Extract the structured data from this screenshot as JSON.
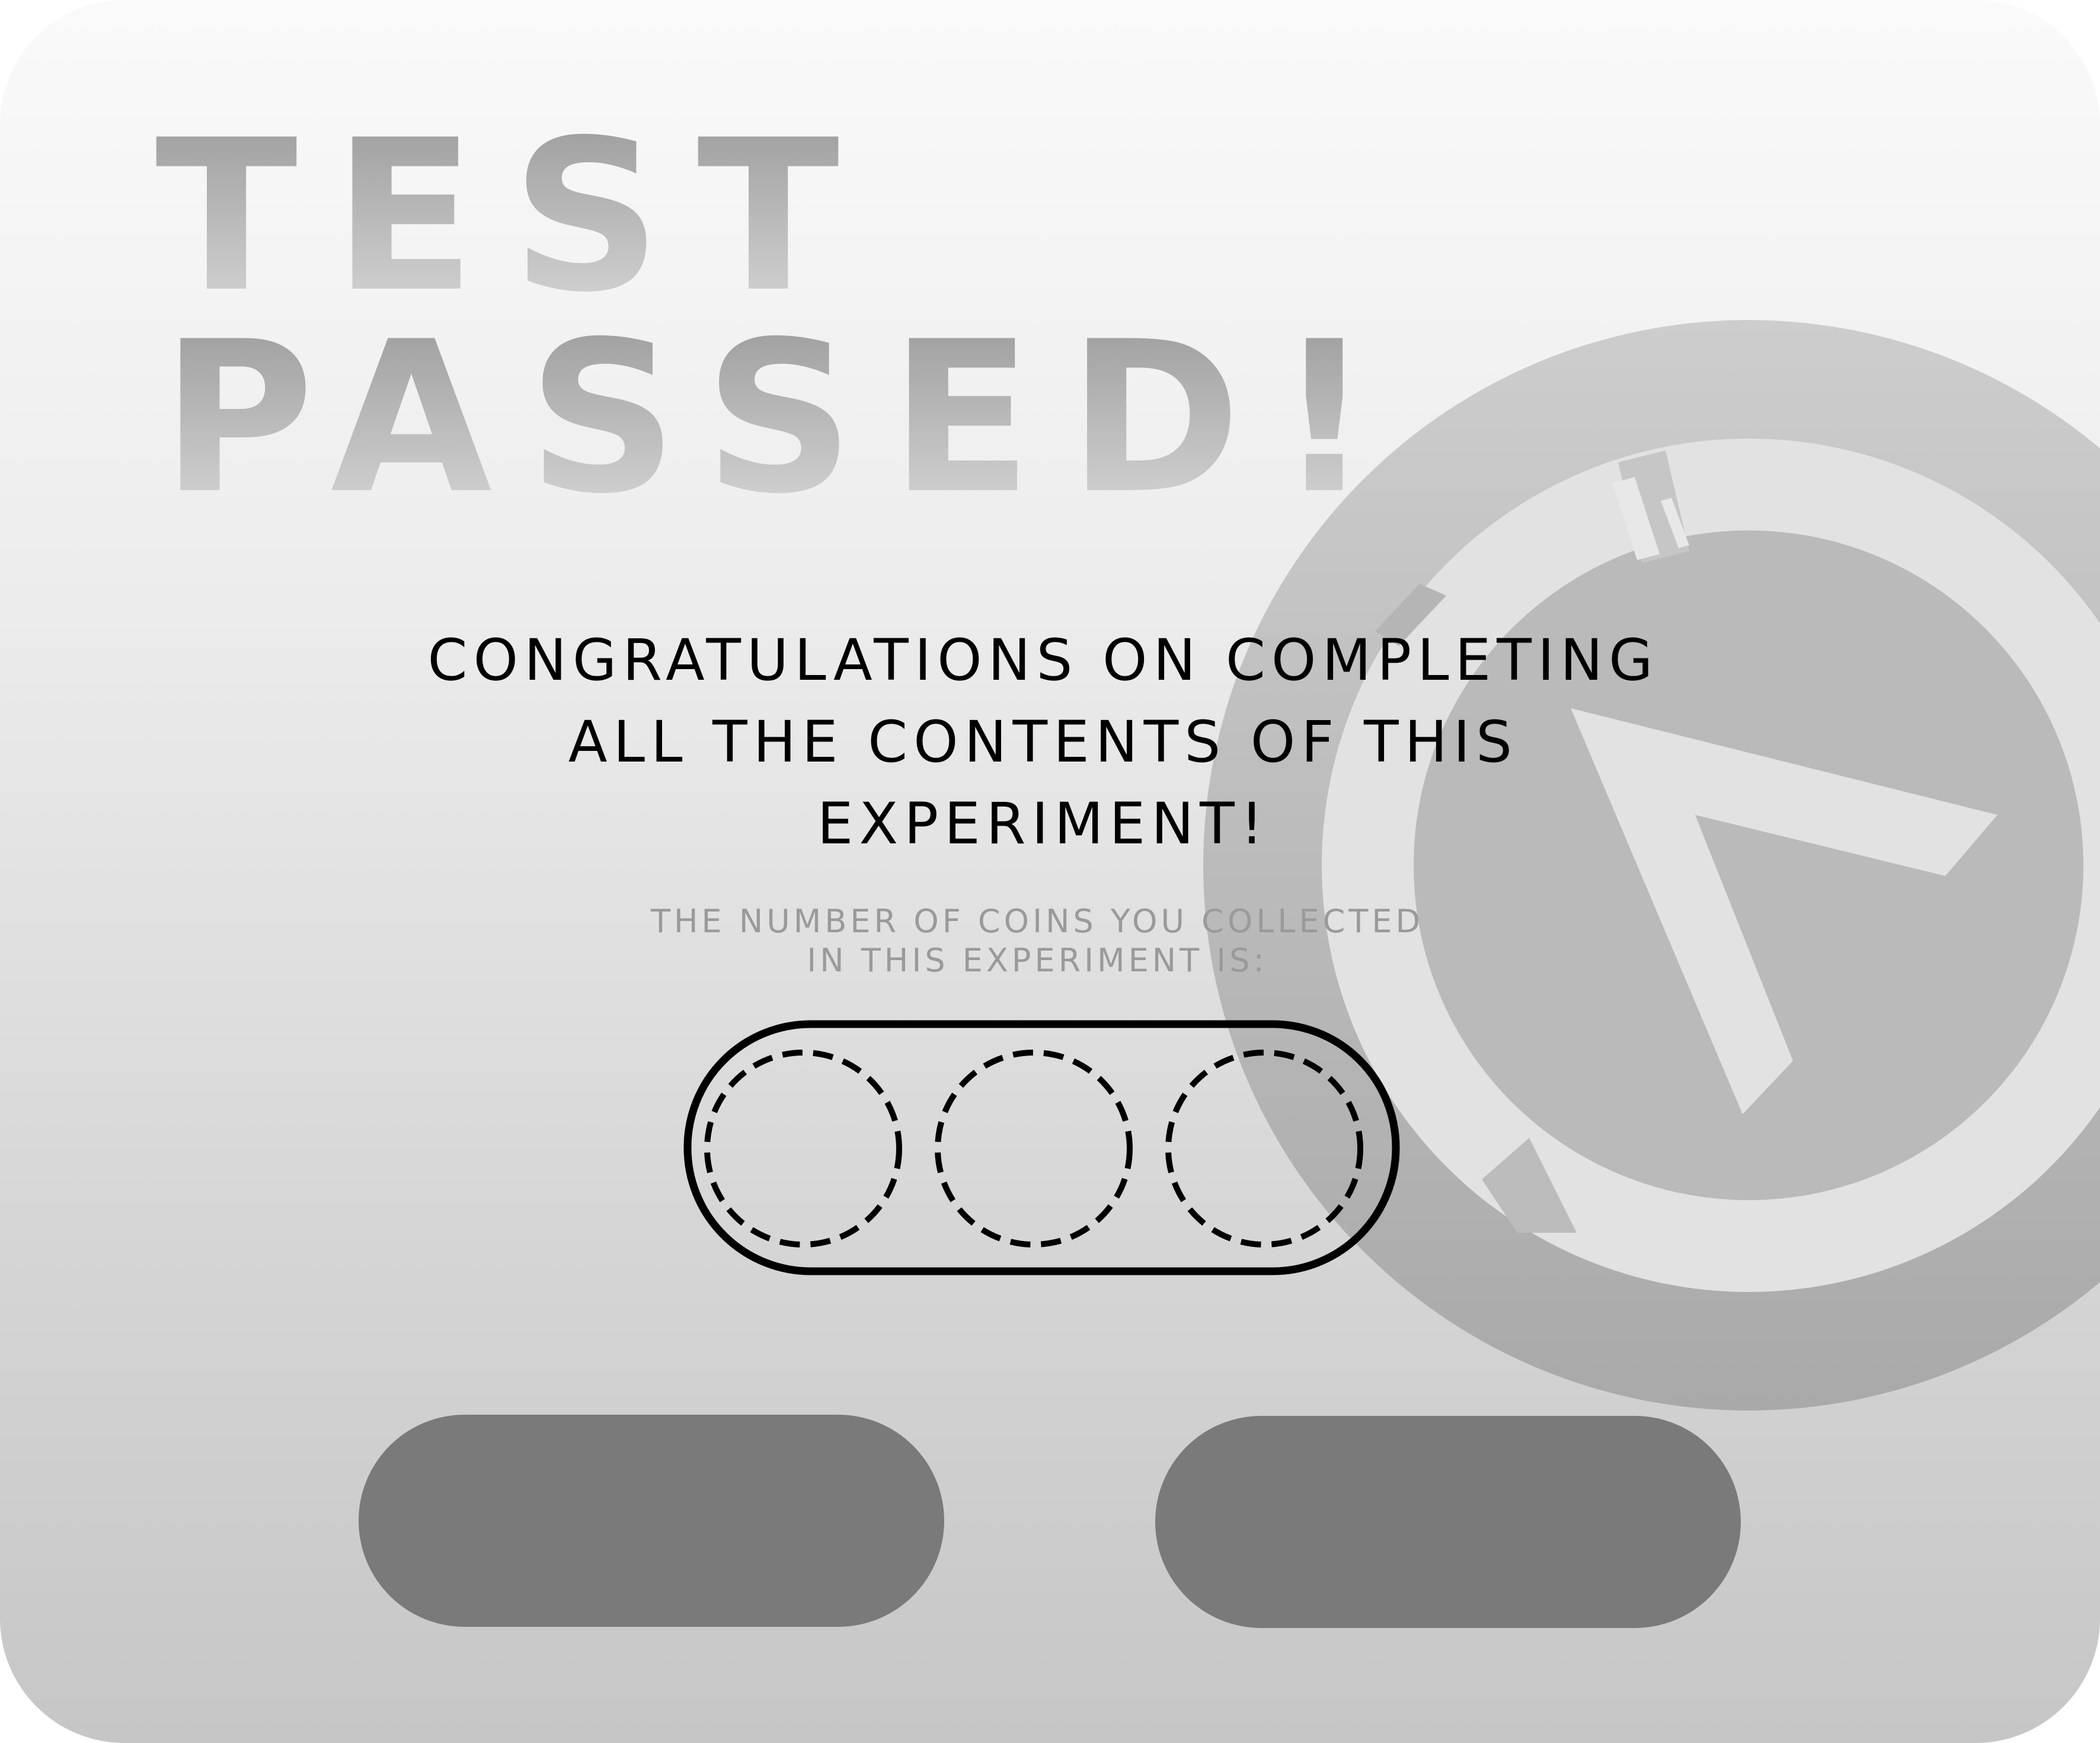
{
  "header": {
    "title_line1": "TEST",
    "title_line2": "PASSED!"
  },
  "message": {
    "congratulations": "CONGRATULATIONS ON COMPLETING\nALL THE CONTENTS OF THIS\nEXPERIMENT!"
  },
  "coins": {
    "caption": "THE NUMBER OF COINS YOU COLLECTED\nIN THIS EXPERIMENT IS:",
    "collected": 0,
    "slots_total": 3
  },
  "buttons": {
    "left_label": "",
    "right_label": ""
  },
  "icons": {
    "emblem": "lambda-emblem-icon",
    "coin_slot": "empty-coin-slot-icon"
  },
  "colors": {
    "panel_top": "#fafafa",
    "panel_bottom": "#c6c6c6",
    "emblem_outer": "#c0c0c0",
    "emblem_ring": "#e2e2e2",
    "emblem_inner": "#b8b8b8",
    "title_text": "#bdbdbd",
    "body_text": "#000000",
    "caption_text": "#9a9a9a",
    "button_fill": "#7a7a7a"
  }
}
